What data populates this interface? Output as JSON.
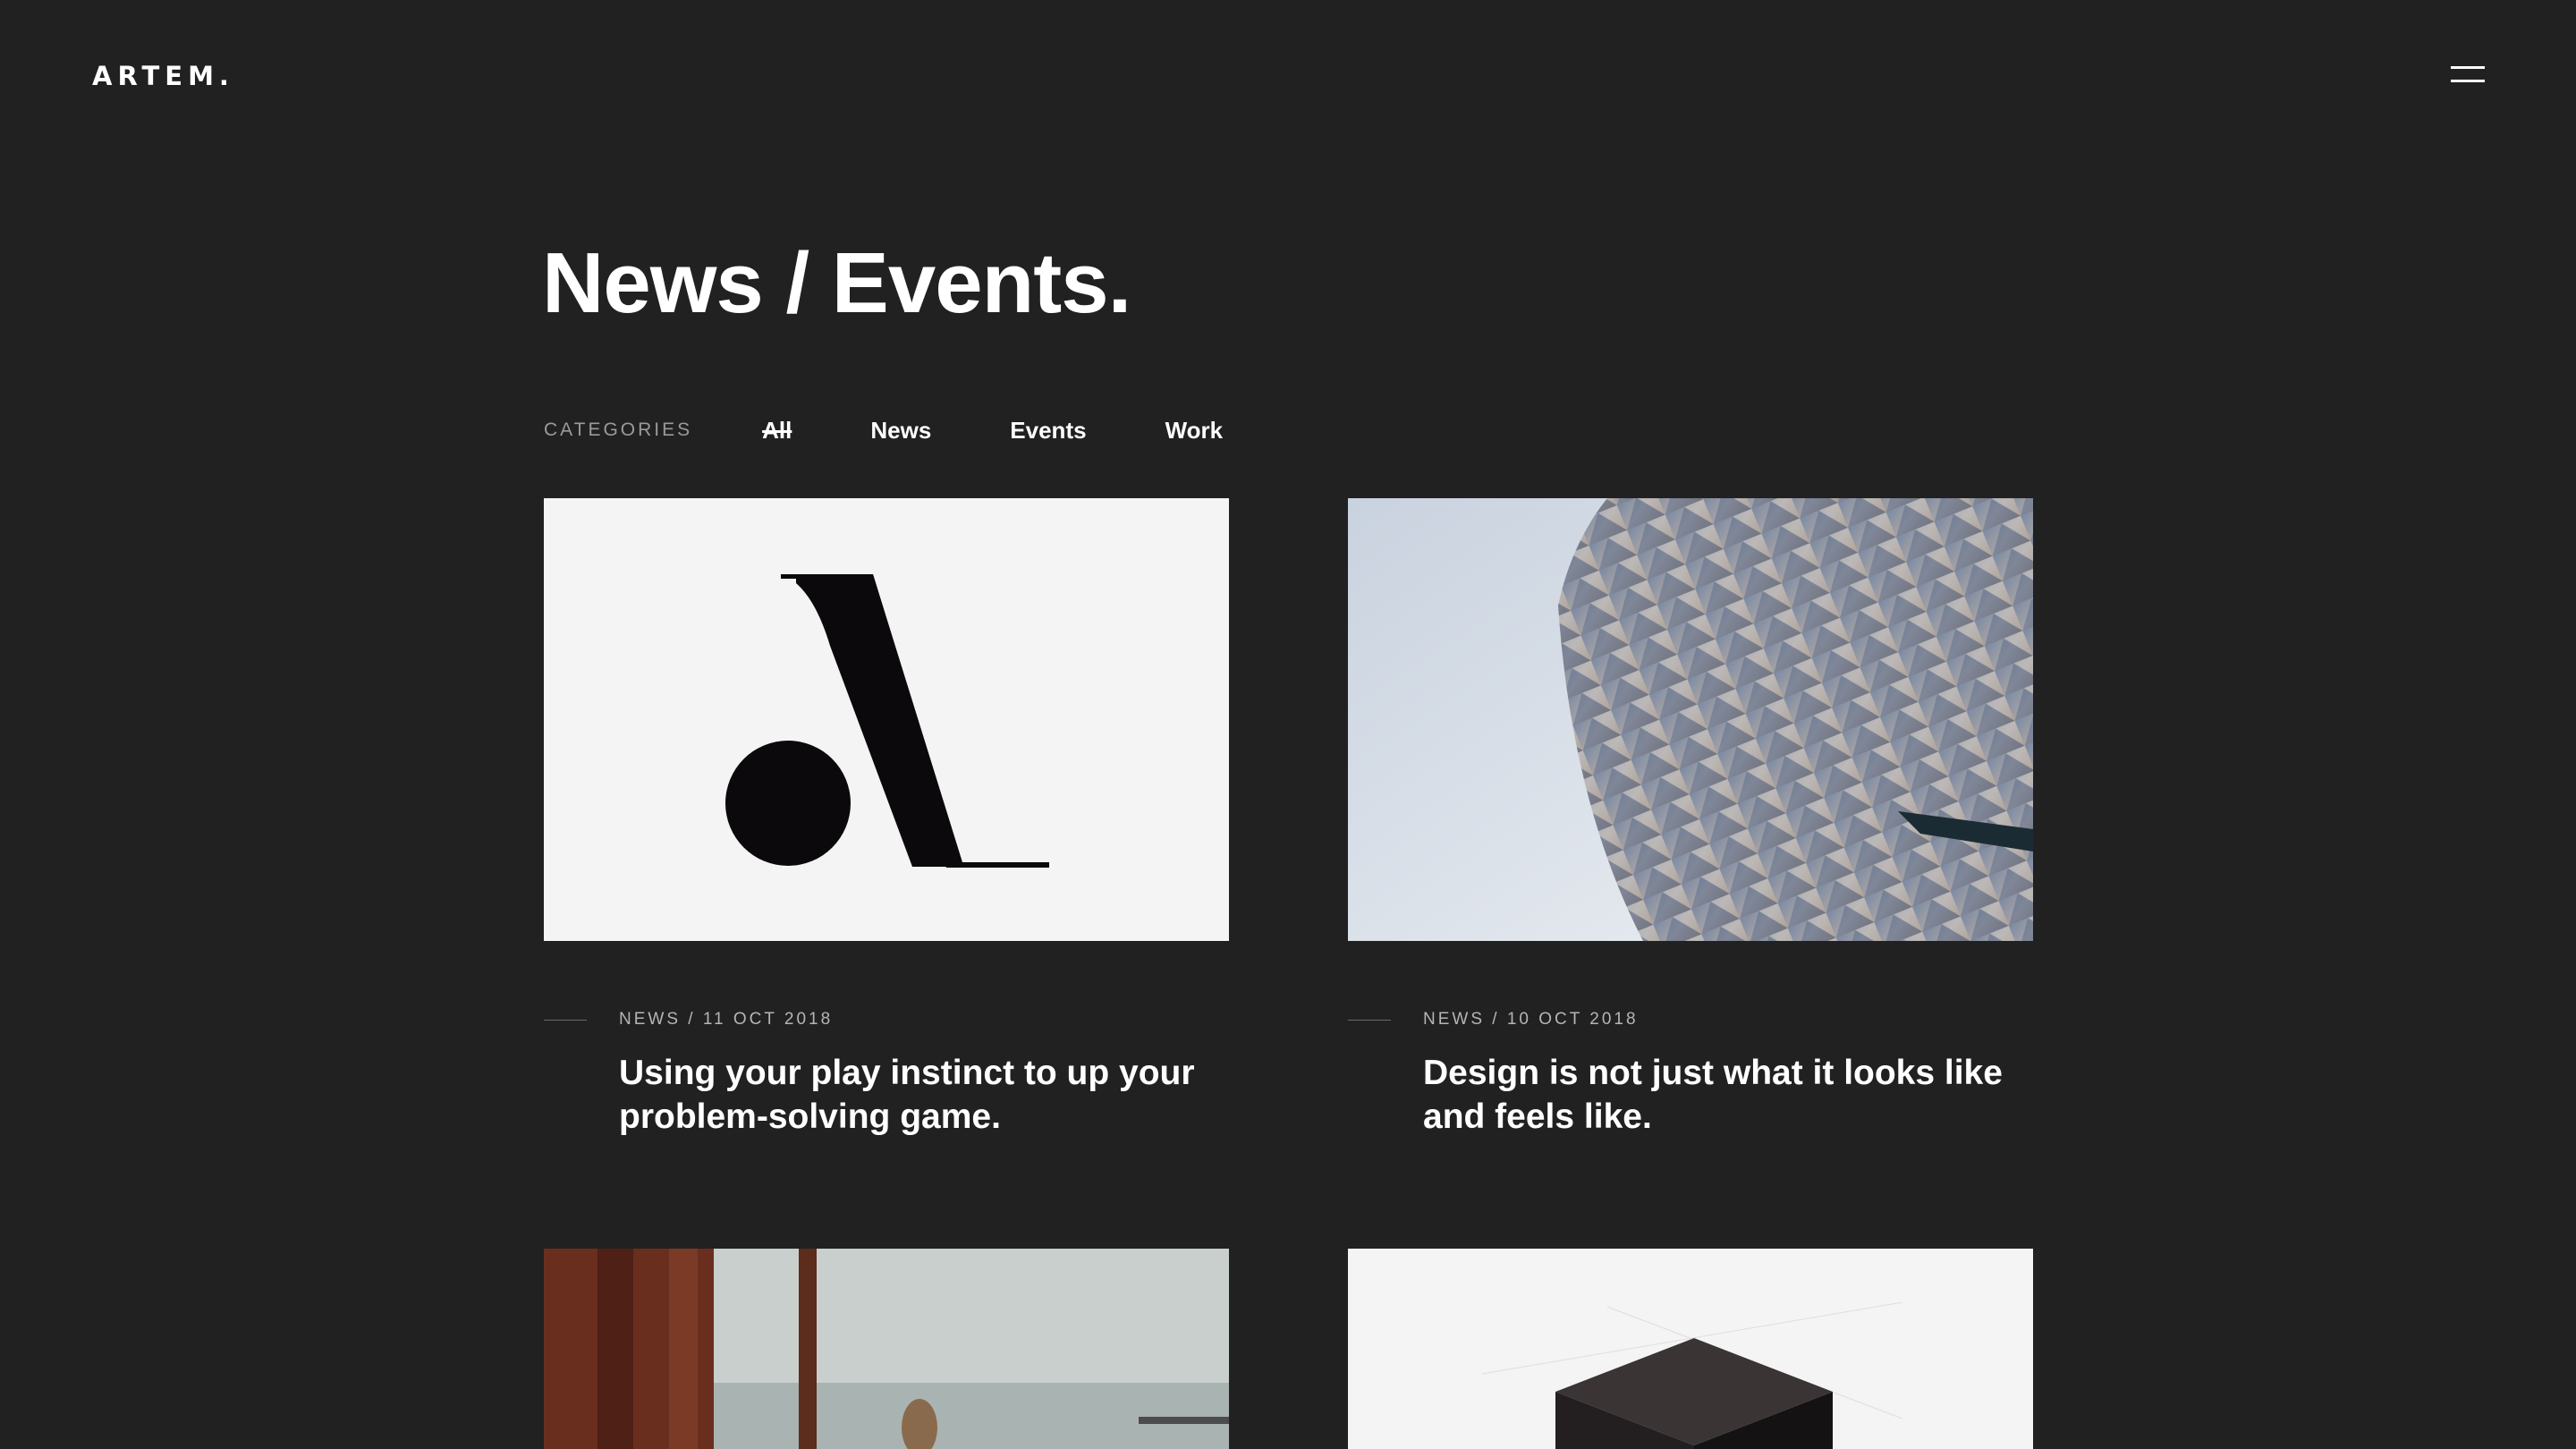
{
  "header": {
    "logo_text": "ARTEM.",
    "menu_icon": "hamburger-menu-icon"
  },
  "page": {
    "title": "News / Events."
  },
  "categories": {
    "label": "CATEGORIES",
    "items": [
      {
        "label": "All",
        "active": true
      },
      {
        "label": "News",
        "active": false
      },
      {
        "label": "Events",
        "active": false
      },
      {
        "label": "Work",
        "active": false
      }
    ]
  },
  "posts": [
    {
      "meta": "NEWS / 11 OCT 2018",
      "title": "Using your play instinct to up your problem-solving game.",
      "image": "logo-mark-image"
    },
    {
      "meta": "NEWS / 10 OCT 2018",
      "title": "Design is not just what it looks like and feels like.",
      "image": "architecture-facade-image"
    },
    {
      "meta": "",
      "title": "",
      "image": "lake-trees-image"
    },
    {
      "meta": "",
      "title": "",
      "image": "dark-cube-image"
    }
  ],
  "colors": {
    "background": "#212121",
    "text": "#ffffff",
    "muted": "#9a9a9a",
    "card_light_bg": "#f4f4f4"
  }
}
